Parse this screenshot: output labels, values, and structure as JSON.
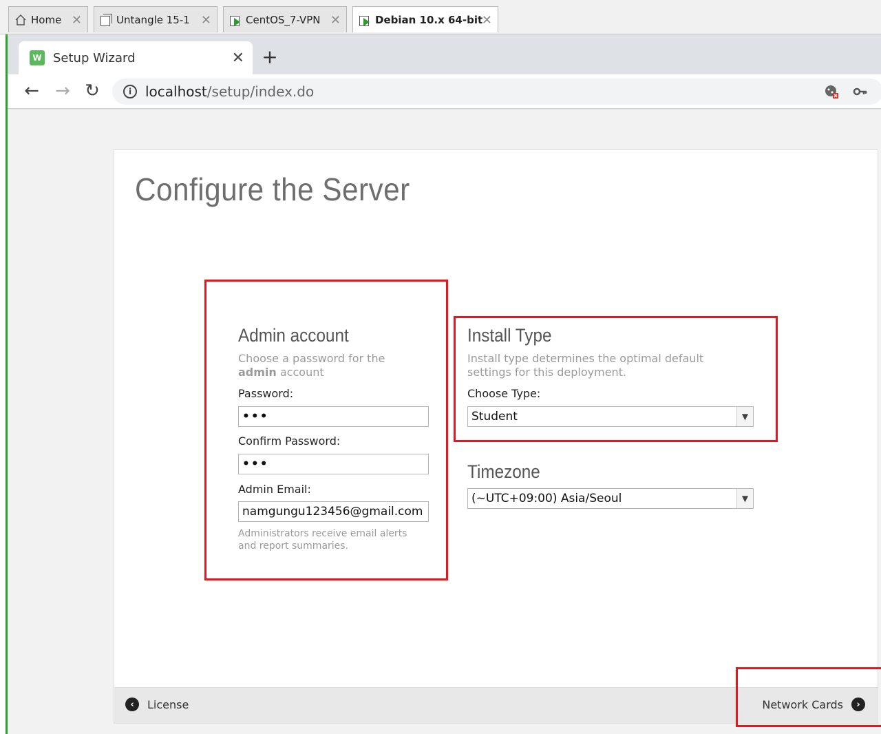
{
  "vm_tabs": [
    {
      "label": "Home"
    },
    {
      "label": "Untangle 15-1"
    },
    {
      "label": "CentOS_7-VPN"
    },
    {
      "label": "Debian 10.x 64-bit"
    }
  ],
  "browser": {
    "tab_title": "Setup Wizard",
    "new_tab": "+",
    "url_host": "localhost",
    "url_path": "/setup/index.do"
  },
  "page": {
    "title": "Configure the Server",
    "admin": {
      "heading": "Admin account",
      "desc_prefix": "Choose a password for the",
      "desc_bold": "admin",
      "desc_suffix": "account",
      "password_label": "Password:",
      "password_value": "•••",
      "confirm_label": "Confirm Password:",
      "confirm_value": "•••",
      "email_label": "Admin Email:",
      "email_value": "namgungu123456@gmail.com",
      "email_help_1": "Administrators receive email alerts",
      "email_help_2": "and report summaries."
    },
    "install": {
      "heading": "Install Type",
      "desc_1": "Install type determines the optimal default",
      "desc_2": "settings for this deployment.",
      "choose_label": "Choose Type:",
      "selected": "Student"
    },
    "timezone": {
      "heading": "Timezone",
      "selected": "(~UTC+09:00) Asia/Seoul"
    },
    "footer": {
      "back_label": "License",
      "next_label": "Network Cards"
    }
  },
  "colors": {
    "highlight": "#e8161c",
    "accent_green": "#2f9d2f"
  }
}
